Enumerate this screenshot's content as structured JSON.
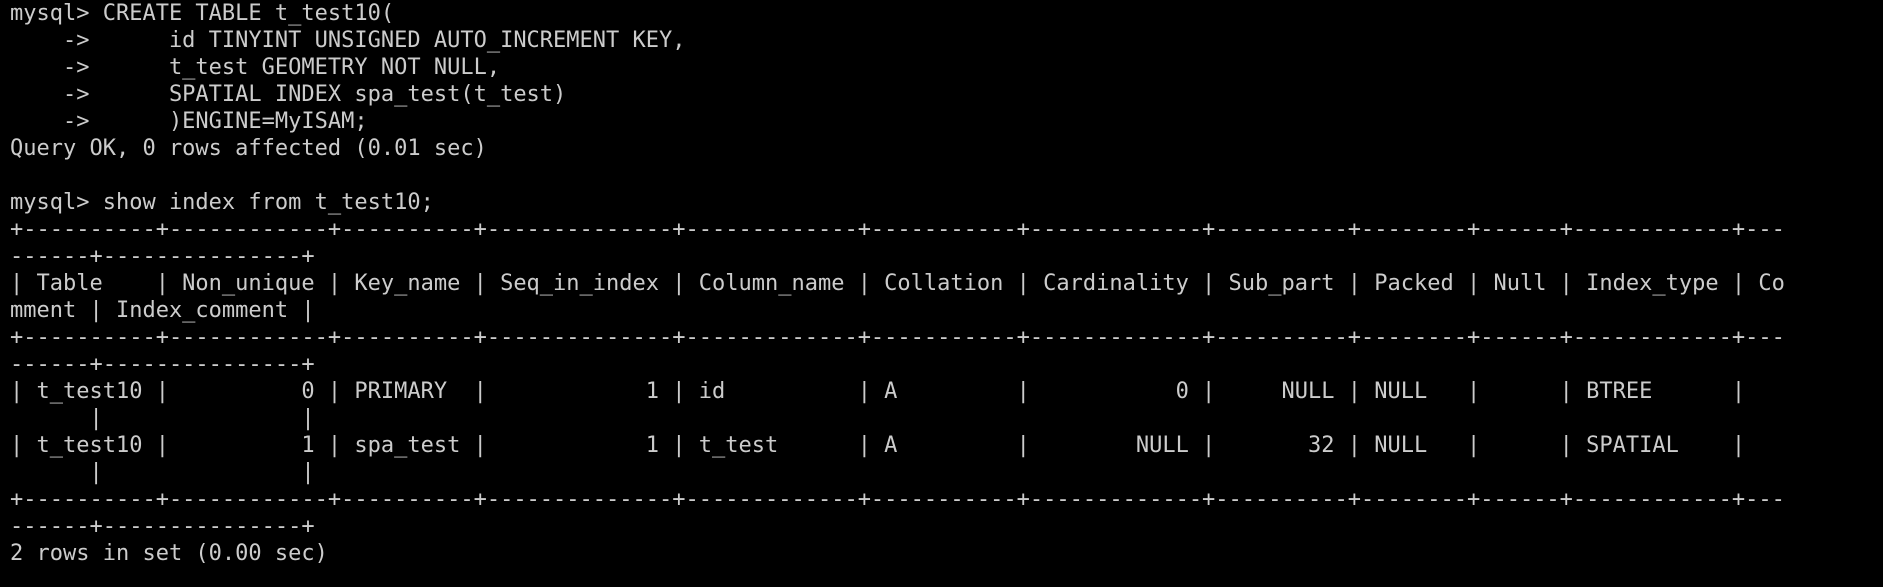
{
  "terminal": {
    "lines": [
      "mysql> CREATE TABLE t_test10(",
      "    ->      id TINYINT UNSIGNED AUTO_INCREMENT KEY,",
      "    ->      t_test GEOMETRY NOT NULL,",
      "    ->      SPATIAL INDEX spa_test(t_test)",
      "    ->      )ENGINE=MyISAM;",
      "Query OK, 0 rows affected (0.01 sec)",
      "",
      "mysql> show index from t_test10;",
      "+----------+------------+----------+--------------+-------------+-----------+-------------+----------+--------+------+------------+---",
      "------+---------------+",
      "| Table    | Non_unique | Key_name | Seq_in_index | Column_name | Collation | Cardinality | Sub_part | Packed | Null | Index_type | Co",
      "mment | Index_comment |",
      "+----------+------------+----------+--------------+-------------+-----------+-------------+----------+--------+------+------------+---",
      "------+---------------+",
      "| t_test10 |          0 | PRIMARY  |            1 | id          | A         |           0 |     NULL | NULL   |      | BTREE      |",
      "      |               |",
      "| t_test10 |          1 | spa_test |            1 | t_test      | A         |        NULL |       32 | NULL   |      | SPATIAL    |",
      "      |               |",
      "+----------+------------+----------+--------------+-------------+-----------+-------------+----------+--------+------+------------+---",
      "------+---------------+",
      "2 rows in set (0.00 sec)"
    ]
  },
  "colors": {
    "background": "#000000",
    "foreground": "#cccccc"
  }
}
